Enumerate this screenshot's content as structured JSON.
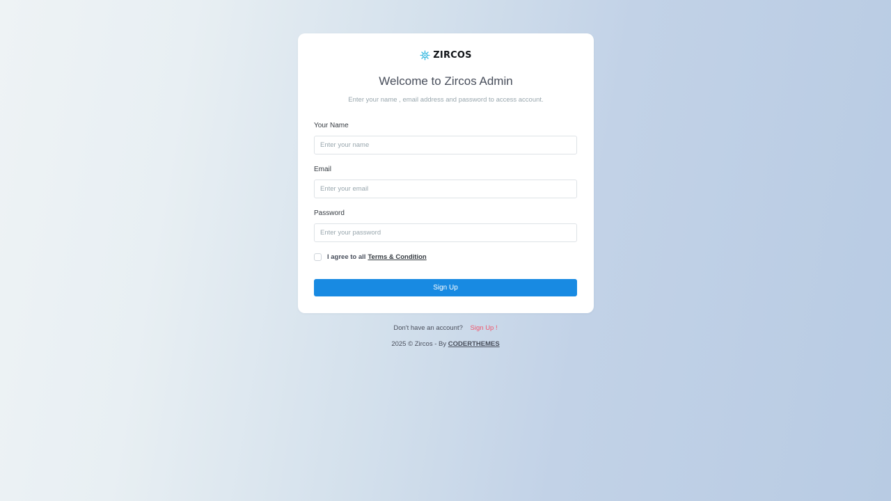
{
  "brand": {
    "name": "ZIRCOS",
    "icon": "sun-gear-icon",
    "icon_color": "#35b8e0"
  },
  "card": {
    "title": "Welcome to Zircos Admin",
    "subtitle": "Enter your name , email address and password to access account."
  },
  "form": {
    "name": {
      "label": "Your Name",
      "placeholder": "Enter your name",
      "value": ""
    },
    "email": {
      "label": "Email",
      "placeholder": "Enter your email",
      "value": ""
    },
    "password": {
      "label": "Password",
      "placeholder": "Enter your password",
      "value": ""
    },
    "agree": {
      "prefix": "I agree to all",
      "link": "Terms & Condition",
      "checked": false
    },
    "submit_label": "Sign Up"
  },
  "footer": {
    "prompt": "Don't have an account?",
    "signup_link": "Sign Up !",
    "copyright": "2025 © Zircos - By",
    "author_link": "CODERTHEMES"
  },
  "colors": {
    "primary": "#188ae2",
    "danger": "#f1556c"
  }
}
